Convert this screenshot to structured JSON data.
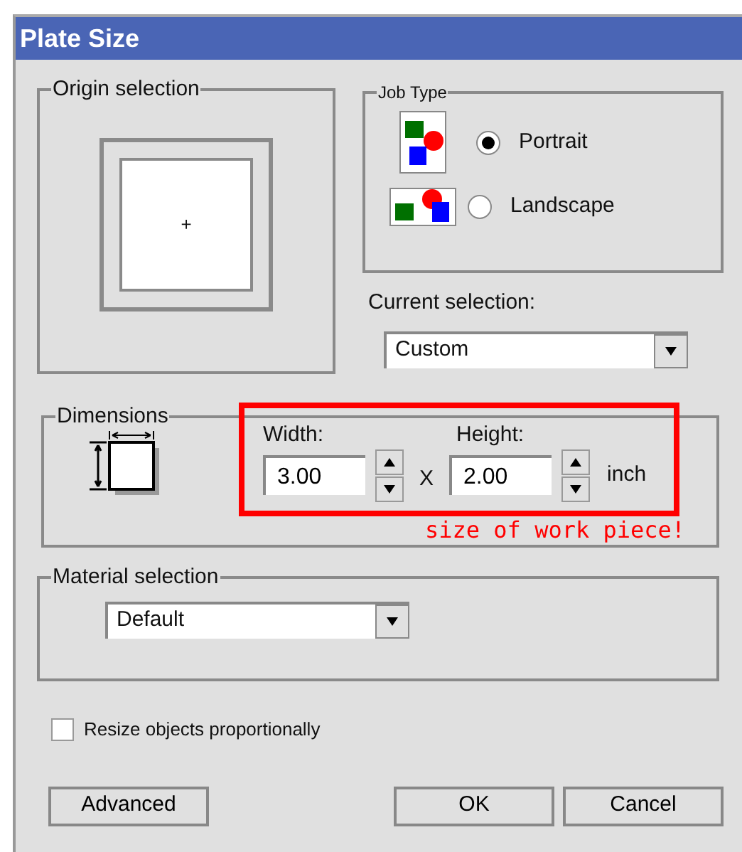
{
  "window": {
    "title": "Plate Size"
  },
  "origin_selection": {
    "label": "Origin selection",
    "marker": "+"
  },
  "job_type": {
    "label": "Job Type",
    "options": [
      {
        "label": "Portrait",
        "selected": true
      },
      {
        "label": "Landscape",
        "selected": false
      }
    ]
  },
  "current_selection": {
    "label": "Current selection:",
    "value": "Custom"
  },
  "dimensions": {
    "label": "Dimensions",
    "width": {
      "label": "Width:",
      "value": "3.00"
    },
    "height": {
      "label": "Height:",
      "value": "2.00"
    },
    "separator": "X",
    "unit": "inch"
  },
  "annotation": {
    "text": "size of work piece!"
  },
  "material_selection": {
    "label": "Material selection",
    "value": "Default"
  },
  "resize_proportionally": {
    "label": "Resize objects proportionally",
    "checked": false
  },
  "buttons": [
    "Advanced",
    "OK",
    "Cancel"
  ]
}
